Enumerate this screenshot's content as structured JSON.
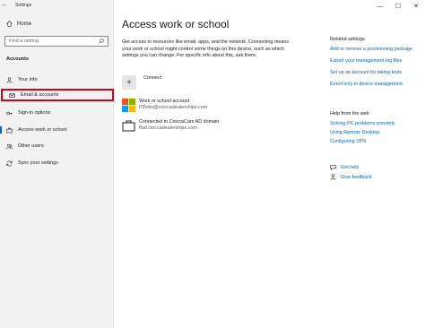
{
  "window": {
    "title": "Settings",
    "back": "←",
    "minimize": "—",
    "maximize": "☐",
    "close": "✕"
  },
  "sidebar": {
    "home": "Home",
    "search_placeholder": "Find a setting",
    "section": "Accounts",
    "items": [
      {
        "label": "Your info",
        "icon": "person-icon"
      },
      {
        "label": "Email & accounts",
        "icon": "envelope-icon"
      },
      {
        "label": "Sign-in options",
        "icon": "key-icon"
      },
      {
        "label": "Access work or school",
        "icon": "briefcase-icon"
      },
      {
        "label": "Other users",
        "icon": "people-icon"
      },
      {
        "label": "Sync your settings",
        "icon": "sync-icon"
      }
    ]
  },
  "main": {
    "title": "Access work or school",
    "description": "Get access to resources like email, apps, and the network. Connecting means your work or school might control some things on this device, such as which settings you can change. For specific info about this, ask them.",
    "connect_label": "Connect",
    "accounts": [
      {
        "title": "Work or school account",
        "subtitle": "PDoku@cioccadealerships.com"
      },
      {
        "title": "Connected to CioccaCars AD domain",
        "subtitle": "ffad.cioccadealerships.com"
      }
    ]
  },
  "related": {
    "heading": "Related settings",
    "links": [
      "Add or remove a provisioning package",
      "Export your management log files",
      "Set up an account for taking tests",
      "Enroll only in device management"
    ]
  },
  "help": {
    "heading": "Help from the web",
    "links": [
      "Solving PC problems remotely",
      "Using Remote Desktop",
      "Configuring VPN"
    ]
  },
  "feedback": {
    "get_help": "Get help",
    "give_feedback": "Give feedback"
  },
  "colors": {
    "accent": "#0067c0",
    "highlight": "#d9001b"
  }
}
